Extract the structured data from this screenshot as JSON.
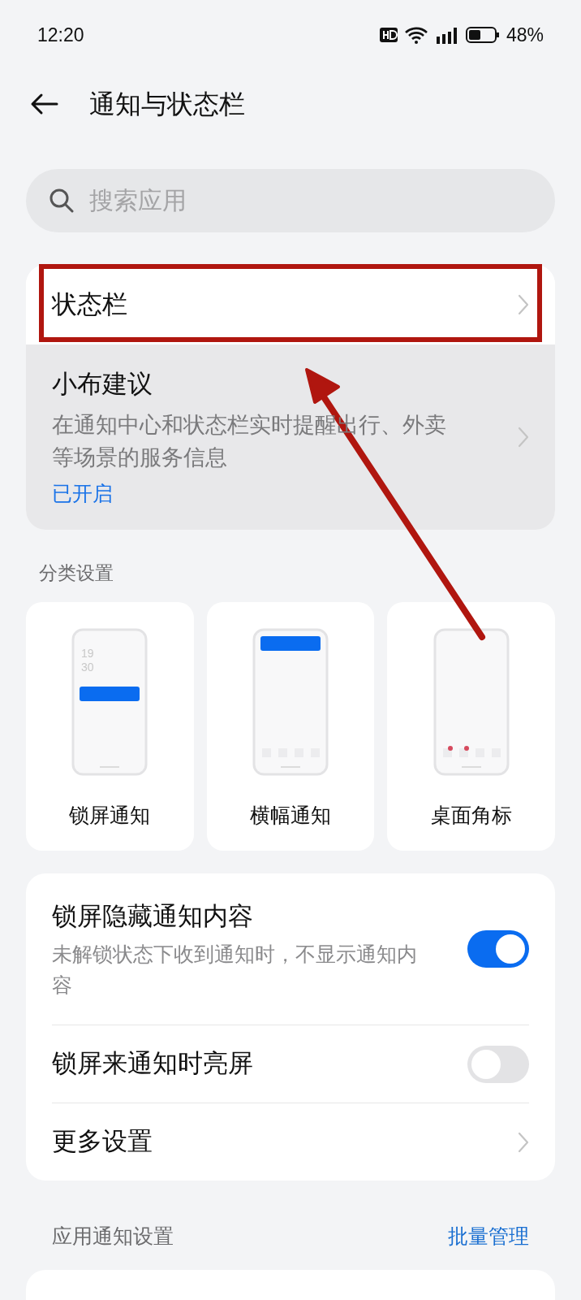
{
  "status_bar": {
    "time": "12:20",
    "battery": "48%"
  },
  "header": {
    "title": "通知与状态栏"
  },
  "search": {
    "placeholder": "搜索应用"
  },
  "top_card": [
    {
      "kind": "link",
      "title": "状态栏",
      "highlighted": false
    },
    {
      "kind": "link",
      "title": "小布建议",
      "description": "在通知中心和状态栏实时提醒出行、外卖等场景的服务信息",
      "status": "已开启",
      "highlighted": true
    }
  ],
  "categories": {
    "title": "分类设置",
    "tiles": [
      {
        "kind": "lock",
        "label": "锁屏通知",
        "clock": [
          "19",
          "30"
        ]
      },
      {
        "kind": "banner",
        "label": "横幅通知"
      },
      {
        "kind": "badge",
        "label": "桌面角标"
      }
    ]
  },
  "settings": [
    {
      "kind": "toggle",
      "title": "锁屏隐藏通知内容",
      "description": "未解锁状态下收到通知时，不显示通知内容",
      "on": true
    },
    {
      "kind": "toggle",
      "title": "锁屏来通知时亮屏",
      "on": false
    },
    {
      "kind": "link",
      "title": "更多设置"
    }
  ],
  "app_section": {
    "title": "应用通知设置",
    "action": "批量管理"
  }
}
